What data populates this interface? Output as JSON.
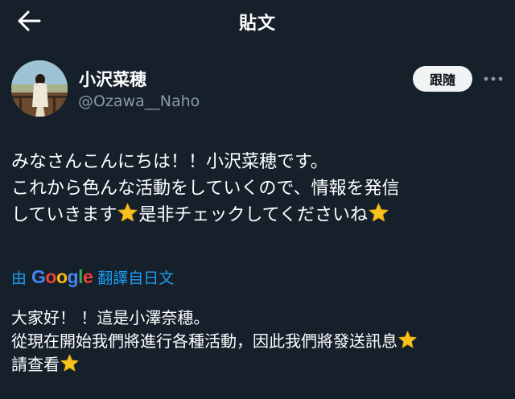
{
  "header": {
    "title": "貼文"
  },
  "user": {
    "display_name": "小沢菜穂",
    "handle": "@Ozawa__Naho"
  },
  "actions": {
    "follow_label": "跟隨"
  },
  "tweet": {
    "lines": [
      "みなさんこんにちは！！小沢菜穂です。",
      "これから色んな活動をしていくので、情報を発信",
      "していきます",
      "是非チェックしてくださいね"
    ]
  },
  "translate": {
    "prefix": "由",
    "google": [
      "G",
      "o",
      "o",
      "g",
      "l",
      "e"
    ],
    "google_colors": [
      "#4285F4",
      "#EA4335",
      "#FBBC05",
      "#4285F4",
      "#34A853",
      "#EA4335"
    ],
    "suffix": "翻譯自日文"
  },
  "translated": {
    "lines": [
      "大家好！ ！這是小澤奈穗。",
      "從現在開始我們將進行各種活動，因此我們將發送訊息",
      "請查看"
    ]
  },
  "icons": {
    "back": "arrow-left-icon",
    "more": "more-horizontal-icon",
    "star": "star-emoji-icon"
  },
  "colors": {
    "background": "#15202b",
    "accent": "#1d9bf0",
    "secondary_text": "#8b98a5",
    "star": "#f7c21d"
  }
}
